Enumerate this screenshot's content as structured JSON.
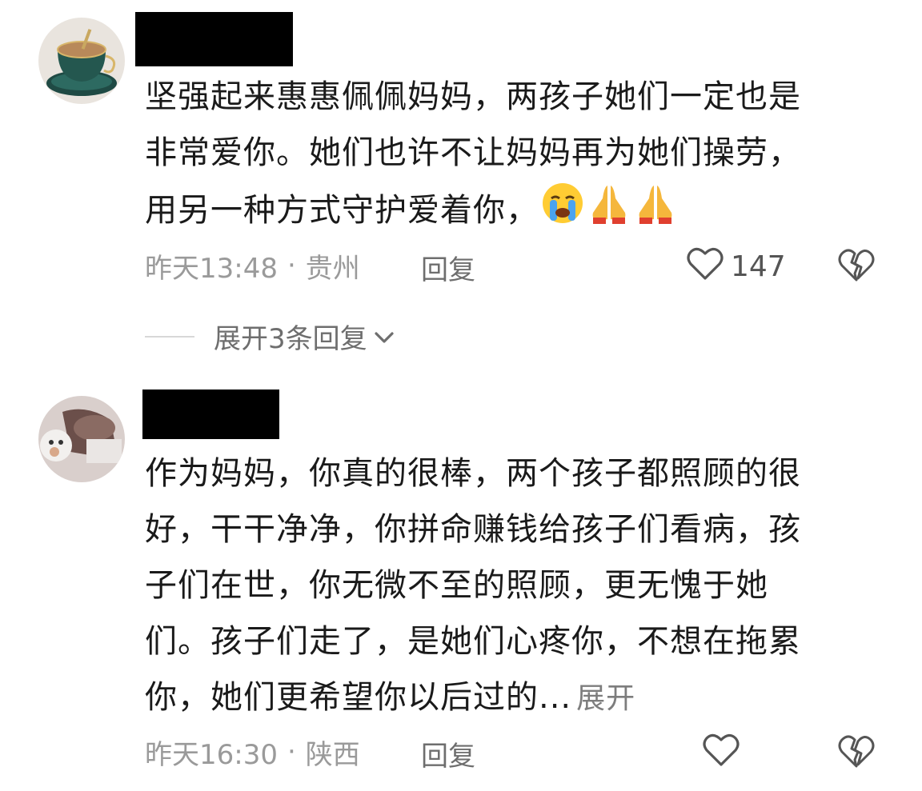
{
  "comments": [
    {
      "lines": [
        "坚强起来惠惠佩佩妈妈，两孩子她们一定也是",
        "非常爱你。她们也许不让妈妈再为她们操劳，",
        "用另一种方式守护爱着你，"
      ],
      "emojis": [
        "loudly-crying-face",
        "folded-hands",
        "folded-hands"
      ],
      "time": "昨天13:48",
      "separator": "·",
      "location": "贵州",
      "reply_label": "回复",
      "like_count": "147",
      "expand_replies": "展开3条回复"
    },
    {
      "lines": [
        "作为妈妈，你真的很棒，两个孩子都照顾的很",
        "好，干干净净，你拼命赚钱给孩子们看病，孩",
        "子们在世，你无微不至的照顾，更无愧于她",
        "们。孩子们走了，是她们心疼你，不想在拖累",
        "你，她们更希望你以后过的..."
      ],
      "expand_label": "展开",
      "time": "昨天16:30",
      "separator": "·",
      "location": "陕西",
      "reply_label": "回复",
      "like_count": ""
    }
  ],
  "colors": {
    "meta_text": "#9a9a9a",
    "action_text": "#6e6e6e",
    "redaction": "#000000"
  }
}
